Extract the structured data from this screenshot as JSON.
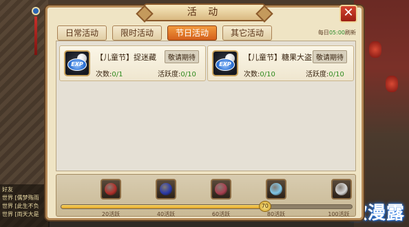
{
  "window": {
    "title": "活 动",
    "close_label": "✕"
  },
  "tabs": [
    {
      "label": "日常活动",
      "active": false
    },
    {
      "label": "限时活动",
      "active": false
    },
    {
      "label": "节日活动",
      "active": true
    },
    {
      "label": "其它活动",
      "active": false
    }
  ],
  "refresh": {
    "prefix": "每日",
    "time": "05:00",
    "suffix": "刷新"
  },
  "activities": [
    {
      "name": "【儿童节】捉迷藏",
      "state": "敬请期待",
      "count_label": "次数:",
      "count": "0/1",
      "active_label": "活跃度:",
      "active": "0/10",
      "icon": "exp-icon"
    },
    {
      "name": "【儿童节】糖果大盗",
      "state": "敬请期待",
      "count_label": "次数:",
      "count": "0/10",
      "active_label": "活跃度:",
      "active": "0/10",
      "icon": "exp-icon"
    }
  ],
  "reward_bar": {
    "current": 70,
    "max": 100,
    "current_label": "70",
    "milestones": [
      {
        "value": 20,
        "label": "20活跃",
        "item": "red-gem-icon",
        "color": "#b0302a"
      },
      {
        "value": 40,
        "label": "40活跃",
        "item": "blue-orb-icon",
        "color": "#2a3aa8"
      },
      {
        "value": 60,
        "label": "60活跃",
        "item": "red-stones-icon",
        "color": "#a84050"
      },
      {
        "value": 80,
        "label": "80活跃",
        "item": "potion-bottle-icon",
        "color": "#7fc6e8"
      },
      {
        "value": 100,
        "label": "100活跃",
        "item": "silver-ingot-icon",
        "color": "#d8d8d8"
      }
    ]
  },
  "chat": [
    "好友",
    "世界 [儒梦殇雨",
    "世界 [此生不负",
    "世界 [両天大是"
  ],
  "watermark": "欧漫露"
}
